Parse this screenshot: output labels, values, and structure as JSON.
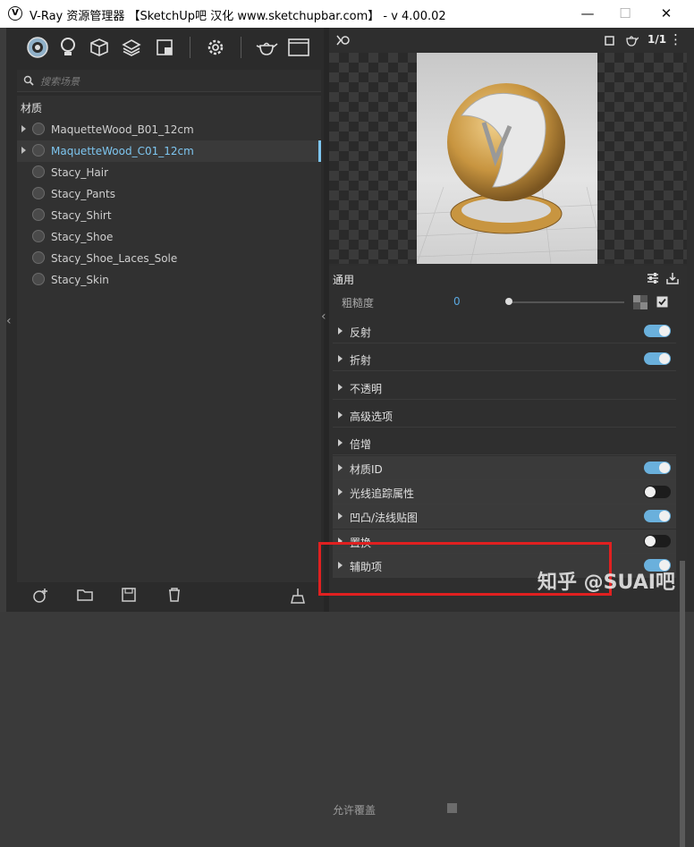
{
  "window": {
    "title": "V-Ray 资源管理器 【SketchUp吧 汉化 www.sketchupbar.com】 - v 4.00.02",
    "logo": "V",
    "minimize": "—",
    "maximize": "☐",
    "close": "✕"
  },
  "toolbar": {
    "icons": [
      "materials-icon",
      "lights-icon",
      "geometry-icon",
      "layers-icon",
      "render-elements-icon",
      "settings-icon",
      "teapot-icon",
      "frame-buffer-icon"
    ]
  },
  "search": {
    "placeholder": "搜索场景"
  },
  "materials": {
    "section_label": "材质",
    "items": [
      {
        "name": "MaquetteWood_B01_12cm",
        "expandable": true,
        "selected": false
      },
      {
        "name": "MaquetteWood_C01_12cm",
        "expandable": true,
        "selected": true
      },
      {
        "name": "Stacy_Hair",
        "expandable": false,
        "selected": false
      },
      {
        "name": "Stacy_Pants",
        "expandable": false,
        "selected": false
      },
      {
        "name": "Stacy_Shirt",
        "expandable": false,
        "selected": false
      },
      {
        "name": "Stacy_Shoe",
        "expandable": false,
        "selected": false
      },
      {
        "name": "Stacy_Shoe_Laces_Sole",
        "expandable": false,
        "selected": false
      },
      {
        "name": "Stacy_Skin",
        "expandable": false,
        "selected": false
      }
    ]
  },
  "bottom_toolbar": {
    "icons": [
      "add-material-icon",
      "open-folder-icon",
      "save-icon",
      "delete-icon",
      "purge-icon"
    ]
  },
  "preview": {
    "ratio_label": "1/1",
    "more": "⋮"
  },
  "properties": {
    "general_label": "通用",
    "roughness_label": "粗糙度",
    "roughness_value": "0",
    "sections": [
      {
        "label": "反射",
        "toggle": true,
        "on": true,
        "dark": false
      },
      {
        "label": "折射",
        "toggle": true,
        "on": true,
        "dark": false
      },
      {
        "label": "不透明",
        "toggle": false,
        "on": false,
        "dark": false
      },
      {
        "label": "高级选项",
        "toggle": false,
        "on": false,
        "dark": false
      },
      {
        "label": "倍增",
        "toggle": false,
        "on": false,
        "dark": false
      },
      {
        "label": "材质ID",
        "toggle": true,
        "on": true,
        "dark": true
      },
      {
        "label": "光线追踪属性",
        "toggle": true,
        "on": false,
        "dark": true
      },
      {
        "label": "凹凸/法线贴图",
        "toggle": true,
        "on": true,
        "dark": true
      },
      {
        "label": "置换",
        "toggle": true,
        "on": false,
        "dark": true
      },
      {
        "label": "辅助项",
        "toggle": true,
        "on": true,
        "dark": true
      }
    ],
    "override_label": "允许覆盖"
  },
  "watermark": "知乎 @SUAI吧",
  "colors": {
    "accent": "#7ec6f0",
    "toggle_on": "#6ab0dc",
    "highlight_box": "#e02020"
  }
}
